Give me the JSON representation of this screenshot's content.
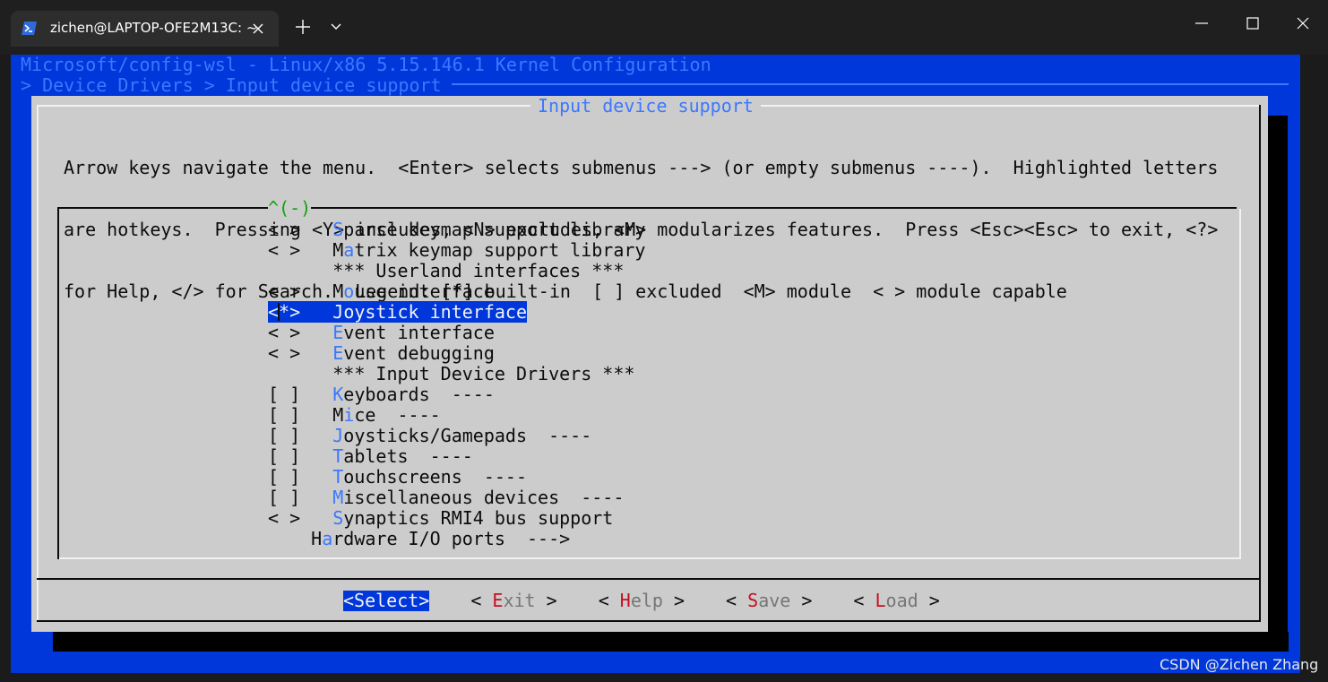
{
  "window": {
    "tab_title": "zichen@LAPTOP-OFE2M13C: ~",
    "accent": "#0037da"
  },
  "header": {
    "line1": "Microsoft/config-wsl - Linux/x86 5.15.146.1 Kernel Configuration",
    "line2": "> Device Drivers > Input device support"
  },
  "dialog": {
    "title": "Input device support",
    "help": [
      "Arrow keys navigate the menu.  <Enter> selects submenus ---> (or empty submenus ----).  Highlighted letters",
      "are hotkeys.  Pressing <Y> includes, <N> excludes, <M> modularizes features.  Press <Esc><Esc> to exit, <?>",
      "for Help, </> for Search.  Legend: [*] built-in  [ ] excluded  <M> module  < > module capable"
    ],
    "scroll_indicator": "^(-)"
  },
  "menu": [
    {
      "state": "< >",
      "indent": "   ",
      "hotkey": "S",
      "rest": "parse keymap support library"
    },
    {
      "state": "< >",
      "indent": "   ",
      "hotkey": "",
      "pre": "M",
      "hk2": "a",
      "rest": "trix keymap support library"
    },
    {
      "state": "   ",
      "indent": "   ",
      "hotkey": "",
      "rest": "*** Userland interfaces ***"
    },
    {
      "state": "< >",
      "indent": "   ",
      "hotkey": "",
      "pre": "M",
      "hk2": "o",
      "rest": "use interface"
    },
    {
      "state": "<*>",
      "indent": "   ",
      "hotkey": "J",
      "rest": "oystick interface",
      "selected": true
    },
    {
      "state": "< >",
      "indent": "   ",
      "hotkey": "E",
      "rest": "vent interface"
    },
    {
      "state": "< >",
      "indent": "   ",
      "hotkey": "E",
      "rest": "vent debugging"
    },
    {
      "state": "   ",
      "indent": "   ",
      "hotkey": "",
      "rest": "*** Input Device Drivers ***"
    },
    {
      "state": "[ ]",
      "indent": "   ",
      "hotkey": "K",
      "rest": "eyboards  ----"
    },
    {
      "state": "[ ]",
      "indent": "   ",
      "hotkey": "",
      "pre": "M",
      "hk2": "i",
      "rest": "ce  ----"
    },
    {
      "state": "[ ]",
      "indent": "   ",
      "hotkey": "J",
      "rest": "oysticks/Gamepads  ----"
    },
    {
      "state": "[ ]",
      "indent": "   ",
      "hotkey": "T",
      "rest": "ablets  ----"
    },
    {
      "state": "[ ]",
      "indent": "   ",
      "hotkey": "T",
      "rest": "ouchscreens  ----"
    },
    {
      "state": "[ ]",
      "indent": "   ",
      "hotkey": "M",
      "rest": "iscellaneous devices  ----"
    },
    {
      "state": "< >",
      "indent": "   ",
      "hotkey": "S",
      "rest": "ynaptics RMI4 bus support"
    },
    {
      "state": "",
      "indent": "    ",
      "hotkey": "",
      "pre": "H",
      "hk2": "a",
      "rest": "rdware I/O ports  --->"
    }
  ],
  "buttons": [
    {
      "label": "<Select>",
      "selected": true
    },
    {
      "open": "< ",
      "hotkey": "E",
      "rest": "xit",
      "close": " >"
    },
    {
      "open": "< ",
      "hotkey": "H",
      "rest": "elp",
      "close": " >"
    },
    {
      "open": "< ",
      "hotkey": "S",
      "rest": "ave",
      "close": " >"
    },
    {
      "open": "< ",
      "hotkey": "L",
      "rest": "oad",
      "close": " >"
    }
  ],
  "watermark": "CSDN @Zichen Zhang"
}
